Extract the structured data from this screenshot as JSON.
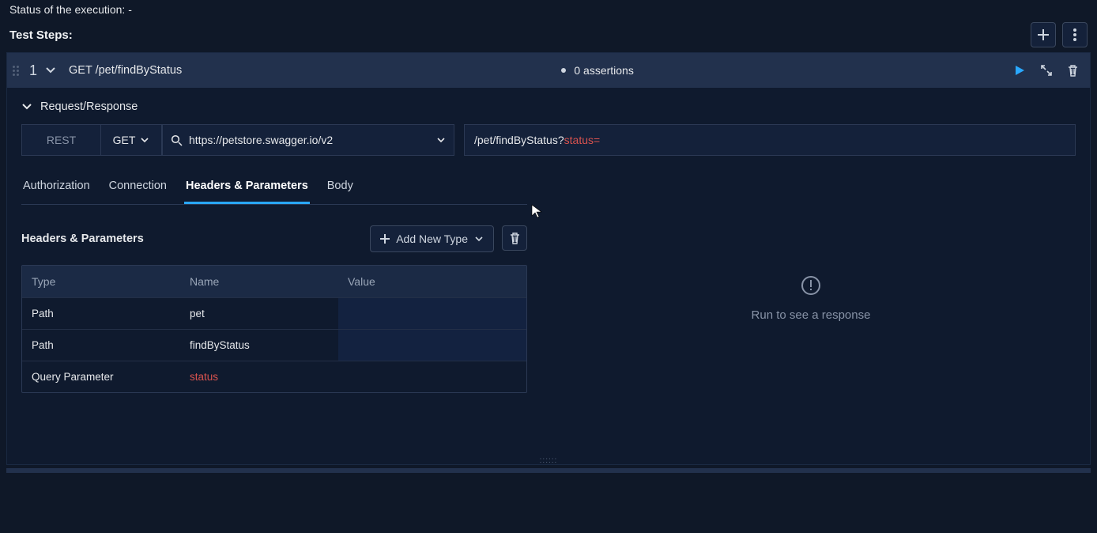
{
  "status_line": "Status of the execution:  -",
  "header": {
    "title": "Test Steps:"
  },
  "step": {
    "index": "1",
    "title": "GET /pet/findByStatus",
    "assertions": "0 assertions"
  },
  "request_response": {
    "section_title": "Request/Response",
    "type": "REST",
    "method": "GET",
    "url": "https://petstore.swagger.io/v2",
    "path_prefix": "/pet/findByStatus?",
    "path_query": "status="
  },
  "tabs": {
    "authorization": "Authorization",
    "connection": "Connection",
    "headers_params": "Headers & Parameters",
    "body": "Body"
  },
  "hp": {
    "title": "Headers & Parameters",
    "add_label": "Add New Type",
    "columns": {
      "type": "Type",
      "name": "Name",
      "value": "Value"
    },
    "rows": [
      {
        "type": "Path",
        "name": "pet",
        "value": "",
        "name_red": false
      },
      {
        "type": "Path",
        "name": "findByStatus",
        "value": "",
        "name_red": false
      },
      {
        "type": "Query Parameter",
        "name": "status",
        "value": "",
        "name_red": true
      }
    ]
  },
  "response_placeholder": "Run to see a response"
}
